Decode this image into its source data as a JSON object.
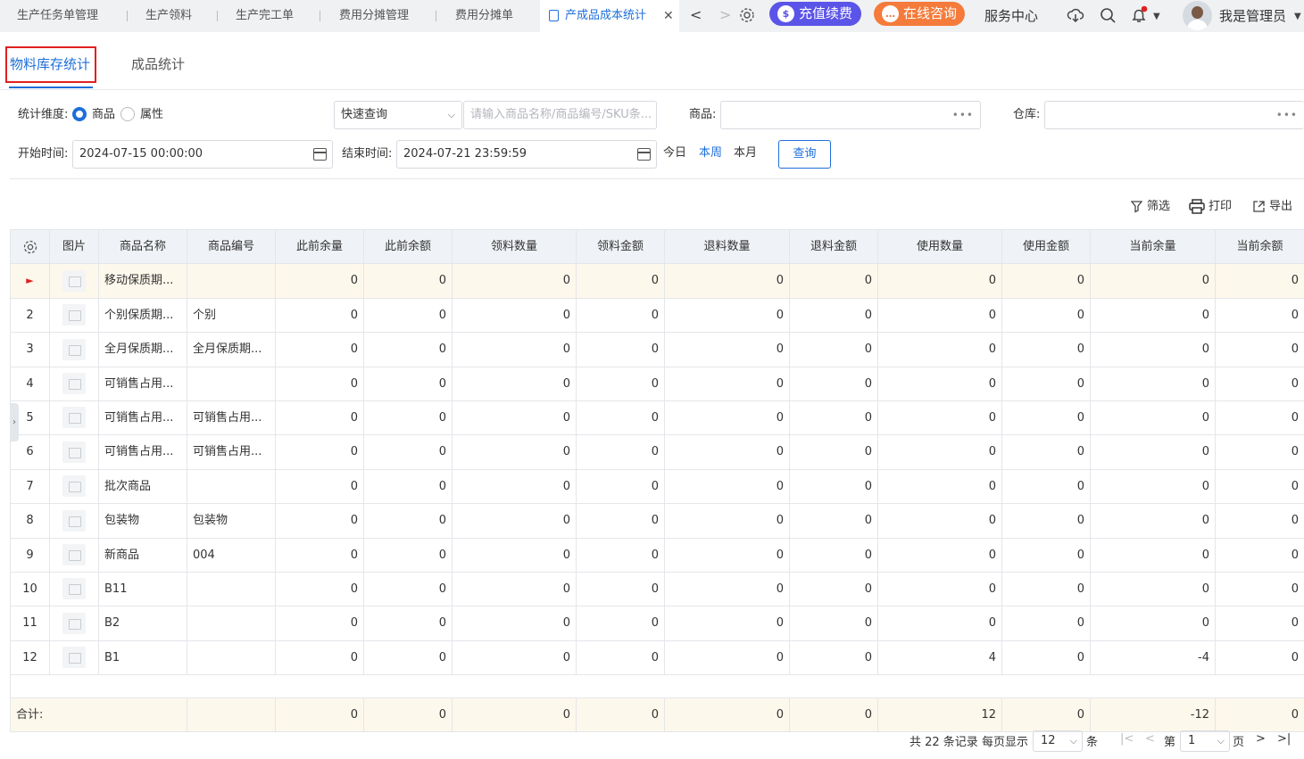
{
  "topbar": {
    "tabs": [
      "生产任务单管理",
      "生产领料",
      "生产完工单",
      "费用分摊管理",
      "费用分摊单"
    ],
    "active_tab": "产成品成本统计",
    "recharge_label": "充值续费",
    "consult_label": "在线咨询",
    "service_label": "服务中心",
    "user_label": "我是管理员"
  },
  "subtabs": [
    "物料库存统计",
    "成品统计"
  ],
  "filters": {
    "dimension_label": "统计维度:",
    "dim_options": [
      "商品",
      "属性"
    ],
    "quick_query": "快速查询",
    "search_placeholder": "请输入商品名称/商品编号/SKU条...",
    "product_label": "商品:",
    "warehouse_label": "仓库:",
    "start_label": "开始时间:",
    "start_value": "2024-07-15 00:00:00",
    "end_label": "结束时间:",
    "end_value": "2024-07-21 23:59:59",
    "quick_dates": [
      "今日",
      "本周",
      "本月"
    ],
    "query_button": "查询"
  },
  "toolbar": {
    "filter": "筛选",
    "print": "打印",
    "export": "导出"
  },
  "table": {
    "headers": [
      "图片",
      "商品名称",
      "商品编号",
      "此前余量",
      "此前余额",
      "领料数量",
      "领料金额",
      "退料数量",
      "退料金额",
      "使用数量",
      "使用金额",
      "当前余量",
      "当前余额"
    ],
    "rows": [
      {
        "idx": "►",
        "name": "移动保质期...",
        "code": "",
        "v": [
          "0",
          "0",
          "0",
          "0",
          "0",
          "0",
          "0",
          "0",
          "0",
          "0"
        ]
      },
      {
        "idx": "2",
        "name": "个别保质期...",
        "code": "个别",
        "v": [
          "0",
          "0",
          "0",
          "0",
          "0",
          "0",
          "0",
          "0",
          "0",
          "0"
        ]
      },
      {
        "idx": "3",
        "name": "全月保质期...",
        "code": "全月保质期...",
        "v": [
          "0",
          "0",
          "0",
          "0",
          "0",
          "0",
          "0",
          "0",
          "0",
          "0"
        ]
      },
      {
        "idx": "4",
        "name": "可销售占用...",
        "code": "",
        "v": [
          "0",
          "0",
          "0",
          "0",
          "0",
          "0",
          "0",
          "0",
          "0",
          "0"
        ]
      },
      {
        "idx": "5",
        "name": "可销售占用...",
        "code": "可销售占用...",
        "v": [
          "0",
          "0",
          "0",
          "0",
          "0",
          "0",
          "0",
          "0",
          "0",
          "0"
        ]
      },
      {
        "idx": "6",
        "name": "可销售占用...",
        "code": "可销售占用...",
        "v": [
          "0",
          "0",
          "0",
          "0",
          "0",
          "0",
          "0",
          "0",
          "0",
          "0"
        ]
      },
      {
        "idx": "7",
        "name": "批次商品",
        "code": "",
        "v": [
          "0",
          "0",
          "0",
          "0",
          "0",
          "0",
          "0",
          "0",
          "0",
          "0"
        ]
      },
      {
        "idx": "8",
        "name": "包装物",
        "code": "包装物",
        "v": [
          "0",
          "0",
          "0",
          "0",
          "0",
          "0",
          "0",
          "0",
          "0",
          "0"
        ]
      },
      {
        "idx": "9",
        "name": "新商品",
        "code": "004",
        "v": [
          "0",
          "0",
          "0",
          "0",
          "0",
          "0",
          "0",
          "0",
          "0",
          "0"
        ]
      },
      {
        "idx": "10",
        "name": "B11",
        "code": "",
        "v": [
          "0",
          "0",
          "0",
          "0",
          "0",
          "0",
          "0",
          "0",
          "0",
          "0"
        ]
      },
      {
        "idx": "11",
        "name": "B2",
        "code": "",
        "v": [
          "0",
          "0",
          "0",
          "0",
          "0",
          "0",
          "0",
          "0",
          "0",
          "0"
        ]
      },
      {
        "idx": "12",
        "name": "B1",
        "code": "",
        "v": [
          "0",
          "0",
          "0",
          "0",
          "0",
          "0",
          "4",
          "0",
          "-4",
          "0"
        ]
      }
    ],
    "sum_label": "合计:",
    "sums": [
      "0",
      "0",
      "0",
      "0",
      "0",
      "0",
      "12",
      "0",
      "-12",
      "0"
    ]
  },
  "pager": {
    "total_text": "共 22 条记录",
    "per_page_label": "每页显示",
    "per_page": "12",
    "unit": "条",
    "page_prefix": "第",
    "page": "1",
    "page_suffix": "页"
  },
  "colors": {
    "accent": "#1e6fd9",
    "recharge": "#5b54e8",
    "consult": "#f47b3b",
    "highlight": "#e02020"
  }
}
